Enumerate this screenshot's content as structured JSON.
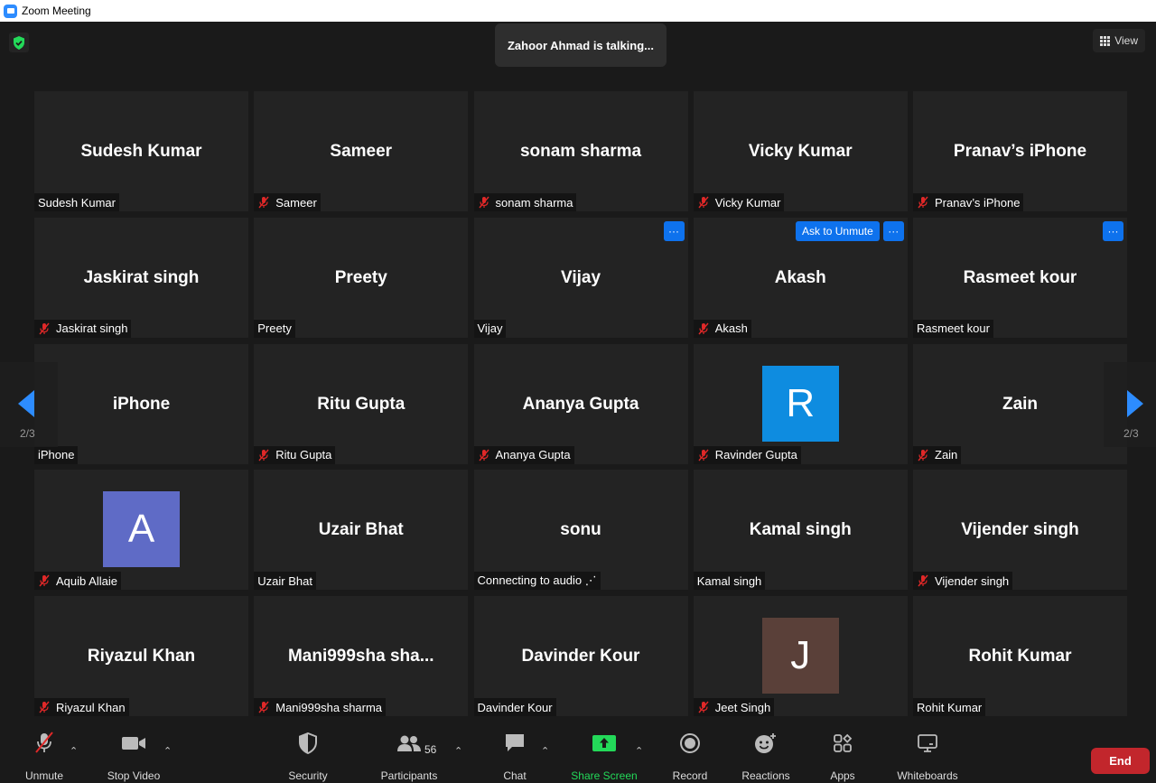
{
  "window": {
    "title": "Zoom Meeting"
  },
  "top": {
    "talking": "Zahoor Ahmad is talking...",
    "view_label": "View"
  },
  "nav": {
    "page_indicator": "2/3"
  },
  "tiles": [
    {
      "big": "Sudesh Kumar",
      "label": "Sudesh Kumar",
      "muted": false
    },
    {
      "big": "Sameer",
      "label": "Sameer",
      "muted": true
    },
    {
      "big": "sonam sharma",
      "label": "sonam sharma",
      "muted": true
    },
    {
      "big": "Vicky Kumar",
      "label": "Vicky Kumar",
      "muted": true
    },
    {
      "big": "Pranav’s iPhone",
      "label": "Pranav’s iPhone",
      "muted": true
    },
    {
      "big": "Jaskirat singh",
      "label": "Jaskirat singh",
      "muted": true
    },
    {
      "big": "Preety",
      "label": "Preety",
      "muted": false
    },
    {
      "big": "Vijay",
      "label": "Vijay",
      "muted": false,
      "more": "···"
    },
    {
      "big": "Akash",
      "label": "Akash",
      "muted": true,
      "more": "···",
      "ask": "Ask to Unmute"
    },
    {
      "big": "Rasmeet kour",
      "label": "Rasmeet kour",
      "muted": false,
      "more": "···"
    },
    {
      "big": "iPhone",
      "label": "iPhone",
      "muted": false
    },
    {
      "big": "Ritu Gupta",
      "label": "Ritu Gupta",
      "muted": true
    },
    {
      "big": "Ananya Gupta",
      "label": "Ananya Gupta",
      "muted": true
    },
    {
      "avatar": "R",
      "avatar_color": "#0e8ce0",
      "label": "Ravinder Gupta",
      "muted": true
    },
    {
      "big": "Zain",
      "label": "Zain",
      "muted": true
    },
    {
      "avatar": "A",
      "avatar_color": "#5f6bc6",
      "label": "Aquib Allaie",
      "muted": true
    },
    {
      "big": "Uzair Bhat",
      "label": "Uzair Bhat",
      "muted": false
    },
    {
      "big": "sonu",
      "label": "Connecting to audio ⋰",
      "muted": false
    },
    {
      "big": "Kamal singh",
      "label": "Kamal singh",
      "muted": false
    },
    {
      "big": "Vijender singh",
      "label": "Vijender singh",
      "muted": true
    },
    {
      "big": "Riyazul Khan",
      "label": "Riyazul Khan",
      "muted": true
    },
    {
      "big": "Mani999sha  sha...",
      "label": "Mani999sha sharma",
      "muted": true
    },
    {
      "big": "Davinder Kour",
      "label": "Davinder Kour",
      "muted": false
    },
    {
      "avatar": "J",
      "avatar_color": "#5a4039",
      "label": "Jeet Singh",
      "muted": true
    },
    {
      "big": "Rohit Kumar",
      "label": "Rohit Kumar",
      "muted": false
    }
  ],
  "toolbar": {
    "unmute": "Unmute",
    "stop_video": "Stop Video",
    "security": "Security",
    "participants": "Participants",
    "participants_count": "56",
    "chat": "Chat",
    "share_screen": "Share Screen",
    "record": "Record",
    "reactions": "Reactions",
    "apps": "Apps",
    "whiteboards": "Whiteboards",
    "end": "End"
  },
  "colors": {
    "accent": "#2d8cff",
    "share_green": "#23d959",
    "end_red": "#c2262c",
    "mute_red": "#e02828"
  }
}
